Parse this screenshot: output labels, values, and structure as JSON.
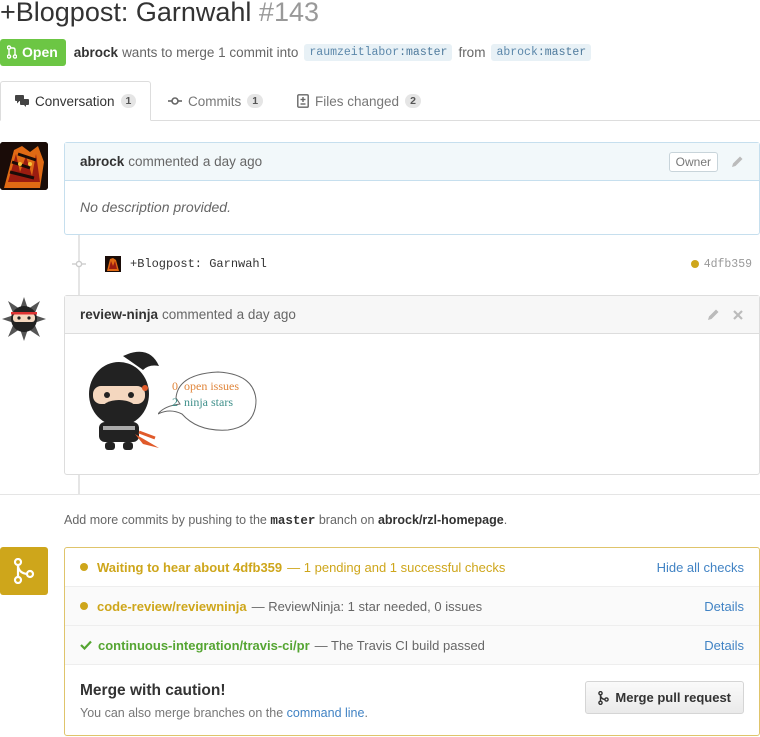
{
  "pr": {
    "title": "+Blogpost: Garnwahl",
    "number": "#143",
    "state": "Open",
    "author": "abrock",
    "merge_text": "wants to merge 1 commit into",
    "base_user": "raumzeitlabor",
    "base_branch": "master",
    "from_text": "from",
    "head_user": "abrock",
    "head_branch": "master"
  },
  "tabs": [
    {
      "label": "Conversation",
      "count": "1",
      "icon": "comment-discussion-icon"
    },
    {
      "label": "Commits",
      "count": "1",
      "icon": "git-commit-icon"
    },
    {
      "label": "Files changed",
      "count": "2",
      "icon": "diff-icon"
    }
  ],
  "comment1": {
    "author": "abrock",
    "action": "commented",
    "time": "a day ago",
    "badge": "Owner",
    "body": "No description provided."
  },
  "commit": {
    "message": "+Blogpost: Garnwahl",
    "sha": "4dfb359"
  },
  "comment2": {
    "author": "review-ninja",
    "action": "commented",
    "time": "a day ago",
    "open_issues_count": "0",
    "open_issues_label": "open issues",
    "stars_count": "2",
    "stars_label": "ninja stars"
  },
  "hint": {
    "prefix": "Add more commits by pushing to the",
    "branch": "master",
    "middle": "branch on",
    "repo": "abrock/rzl-homepage",
    "suffix": "."
  },
  "checks": {
    "summary_title": "Waiting to hear about 4dfb359",
    "summary_detail": "— 1 pending and 1 successful checks",
    "hide_label": "Hide all checks",
    "items": [
      {
        "context": "code-review/reviewninja",
        "description": "— ReviewNinja: 1 star needed, 0 issues",
        "link": "Details",
        "status": "pending"
      },
      {
        "context": "continuous-integration/travis-ci/pr",
        "description": "— The Travis CI build passed",
        "link": "Details",
        "status": "success"
      }
    ],
    "merge_title": "Merge with caution!",
    "merge_hint_prefix": "You can also merge branches on the",
    "merge_hint_link": "command line",
    "merge_hint_suffix": ".",
    "merge_button": "Merge pull request"
  },
  "colors": {
    "open_green": "#6cc644",
    "pending_yellow": "#cea61b",
    "success_green": "#55a532",
    "link_blue": "#4183c4"
  }
}
